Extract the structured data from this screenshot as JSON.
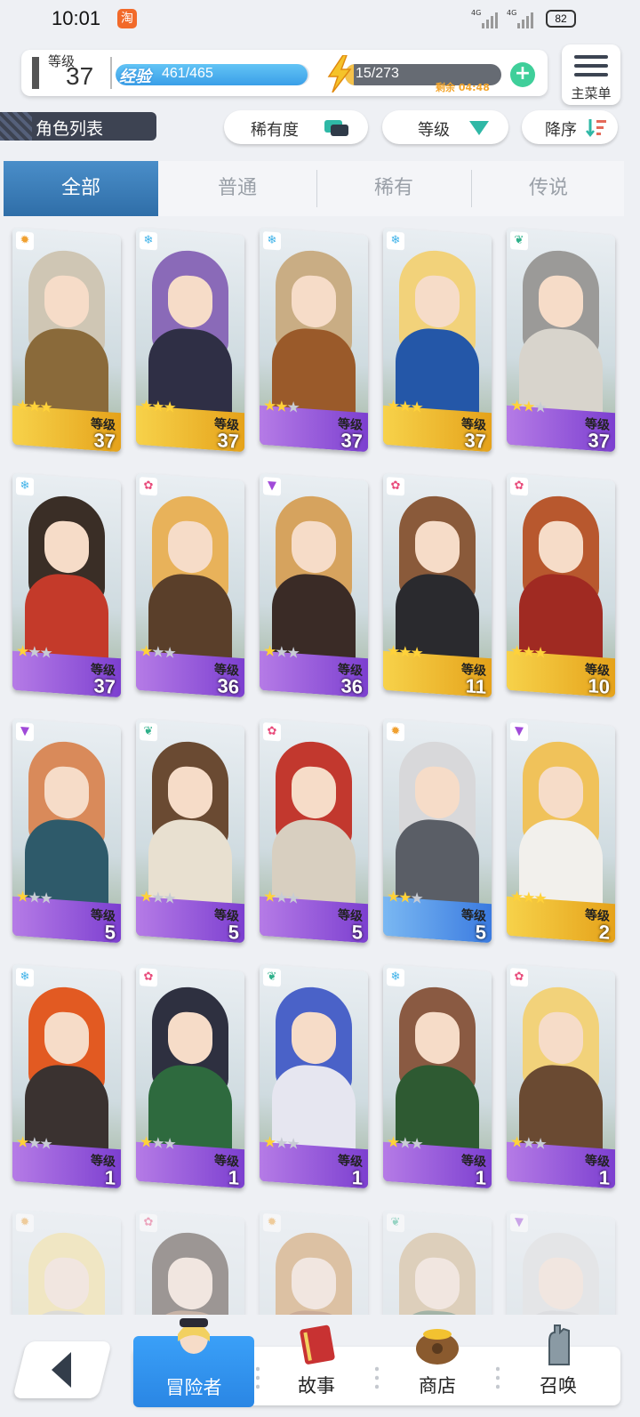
{
  "status": {
    "time": "10:01",
    "app_badge": "淘",
    "signal1": "4G",
    "signal2": "4G",
    "battery": "82"
  },
  "header": {
    "level_label": "等级",
    "level_value": "37",
    "exp_label": "经验",
    "exp_value": "461/465",
    "exp_fraction": 0.99,
    "stamina_value": "15/273",
    "stamina_fraction": 0.055,
    "stamina_timer": "剩余 04:48",
    "plus": "+"
  },
  "menu": {
    "label": "主菜单"
  },
  "toolbar": {
    "list_title": "角色列表",
    "rarity": "稀有度",
    "level": "等级",
    "order": "降序"
  },
  "tabs": [
    {
      "label": "全部"
    },
    {
      "label": "普通"
    },
    {
      "label": "稀有"
    },
    {
      "label": "传说"
    }
  ],
  "cards": [
    {
      "level": "37",
      "level_label": "等级",
      "stars": 3,
      "band": "gold",
      "element": "sun",
      "hair": "#cfc6b4",
      "outfit": "#8a6a3a"
    },
    {
      "level": "37",
      "level_label": "等级",
      "stars": 3,
      "band": "gold",
      "element": "ice",
      "hair": "#8a6ab8",
      "outfit": "#2f2f45"
    },
    {
      "level": "37",
      "level_label": "等级",
      "stars": 2,
      "band": "purple",
      "element": "ice",
      "hair": "#c9ad84",
      "outfit": "#9a5a2a"
    },
    {
      "level": "37",
      "level_label": "等级",
      "stars": 3,
      "band": "gold",
      "element": "ice",
      "hair": "#f2d27a",
      "outfit": "#2457a8"
    },
    {
      "level": "37",
      "level_label": "等级",
      "stars": 2,
      "band": "purple",
      "element": "leaf",
      "hair": "#9b9a98",
      "outfit": "#d8d4cc"
    },
    {
      "level": "37",
      "level_label": "等级",
      "stars": 1,
      "band": "purple",
      "element": "ice",
      "hair": "#3a2e26",
      "outfit": "#c43a2a"
    },
    {
      "level": "36",
      "level_label": "等级",
      "stars": 1,
      "band": "purple",
      "element": "flower",
      "hair": "#e8b25a",
      "outfit": "#5a3f2a"
    },
    {
      "level": "36",
      "level_label": "等级",
      "stars": 1,
      "band": "purple",
      "element": "dark",
      "hair": "#d6a35e",
      "outfit": "#3a2b26"
    },
    {
      "level": "11",
      "level_label": "等级",
      "stars": 3,
      "band": "gold",
      "element": "flower",
      "hair": "#8a5a3a",
      "outfit": "#2a2a2e"
    },
    {
      "level": "10",
      "level_label": "等级",
      "stars": 3,
      "band": "gold",
      "element": "flower",
      "hair": "#b8582e",
      "outfit": "#a02a22"
    },
    {
      "level": "5",
      "level_label": "等级",
      "stars": 1,
      "band": "purple",
      "element": "dark",
      "hair": "#d98a5a",
      "outfit": "#2e5a6a"
    },
    {
      "level": "5",
      "level_label": "等级",
      "stars": 1,
      "band": "purple",
      "element": "leaf",
      "hair": "#6a4a32",
      "outfit": "#e8e0d0"
    },
    {
      "level": "5",
      "level_label": "等级",
      "stars": 1,
      "band": "purple",
      "element": "flower",
      "hair": "#c2382e",
      "outfit": "#d8cfc0"
    },
    {
      "level": "5",
      "level_label": "等级",
      "stars": 2,
      "band": "blue",
      "element": "sun",
      "hair": "#d8d8da",
      "outfit": "#5a5e66"
    },
    {
      "level": "2",
      "level_label": "等级",
      "stars": 3,
      "band": "gold",
      "element": "dark",
      "hair": "#f0c25a",
      "outfit": "#f2f0ec"
    },
    {
      "level": "1",
      "level_label": "等级",
      "stars": 1,
      "band": "purple",
      "element": "ice",
      "hair": "#e25a22",
      "outfit": "#3a3230"
    },
    {
      "level": "1",
      "level_label": "等级",
      "stars": 1,
      "band": "purple",
      "element": "flower",
      "hair": "#2e3040",
      "outfit": "#2e6a3e"
    },
    {
      "level": "1",
      "level_label": "等级",
      "stars": 1,
      "band": "purple",
      "element": "leaf",
      "hair": "#4a62c8",
      "outfit": "#e6e6f0"
    },
    {
      "level": "1",
      "level_label": "等级",
      "stars": 1,
      "band": "purple",
      "element": "ice",
      "hair": "#8a5a42",
      "outfit": "#2e5a32"
    },
    {
      "level": "1",
      "level_label": "等级",
      "stars": 1,
      "band": "purple",
      "element": "flower",
      "hair": "#f2d27a",
      "outfit": "#6a4a32"
    },
    {
      "level": "",
      "level_label": "",
      "stars": 0,
      "band": "gold",
      "element": "sun",
      "hair": "#f4dc8a",
      "outfit": "#c8c2b4",
      "faded": true
    },
    {
      "level": "",
      "level_label": "",
      "stars": 0,
      "band": "purple",
      "element": "flower",
      "hair": "#3a2a22",
      "outfit": "#9a6a4a",
      "faded": true
    },
    {
      "level": "",
      "level_label": "",
      "stars": 0,
      "band": "purple",
      "element": "sun",
      "hair": "#c88a42",
      "outfit": "#a05a2a",
      "faded": true
    },
    {
      "level": "",
      "level_label": "",
      "stars": 0,
      "band": "purple",
      "element": "leaf",
      "hair": "#c9a878",
      "outfit": "#4a6a4a",
      "faded": true
    },
    {
      "level": "",
      "level_label": "",
      "stars": 0,
      "band": "purple",
      "element": "dark",
      "hair": "#d8d8d8",
      "outfit": "#c8c8c8",
      "faded": true
    }
  ],
  "nav": [
    {
      "label": "冒险者",
      "active": true
    },
    {
      "label": "故事"
    },
    {
      "label": "商店"
    },
    {
      "label": "召唤"
    }
  ],
  "colors": {
    "accent": "#2f6ea8",
    "gold": "#f2c230",
    "purple": "#8a4ad6",
    "blue": "#3a7ae0"
  }
}
